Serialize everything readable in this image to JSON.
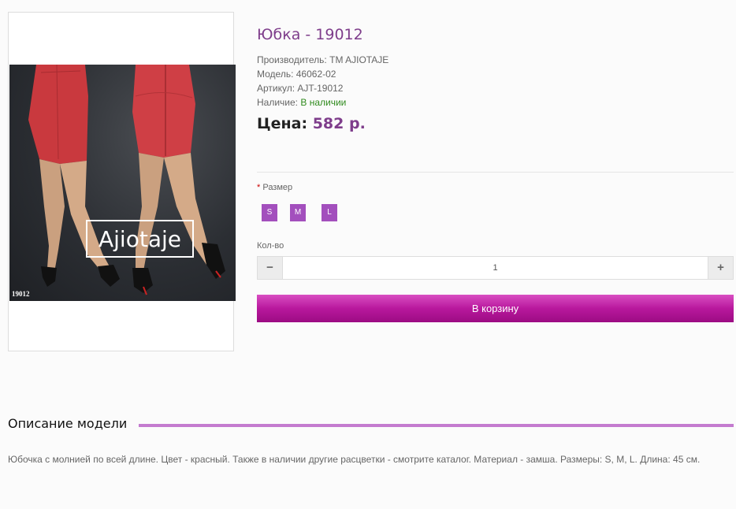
{
  "product": {
    "title": "Юбка - 19012",
    "manufacturer_label": "Производитель:",
    "manufacturer": "TM AJIOTAJE",
    "model_label": "Модель:",
    "model": "46062-02",
    "article_label": "Артикул:",
    "article": "AJT-19012",
    "availability_label": "Наличие:",
    "availability": "В наличии",
    "price_label": "Цена:",
    "price": "582 р."
  },
  "image": {
    "brand": "Ajiotaje",
    "sku_tag": "19012"
  },
  "options": {
    "required_mark": "*",
    "size_label": "Размер",
    "sizes": [
      "S",
      "M",
      "L"
    ]
  },
  "quantity": {
    "label": "Кол-во",
    "minus": "−",
    "value": "1",
    "plus": "+"
  },
  "cart_button": "В корзину",
  "description": {
    "heading": "Описание модели",
    "text": "Юбочка с молнией по всей длине. Цвет - красный. Также в наличии другие расцветки - смотрите каталог. Материал - замша. Размеры: S, M, L. Длина: 45 см."
  },
  "colors": {
    "accent": "#7e3d8b",
    "button": "#b8189d",
    "size_button": "#a34fbd",
    "in_stock": "#2f8a1c"
  }
}
